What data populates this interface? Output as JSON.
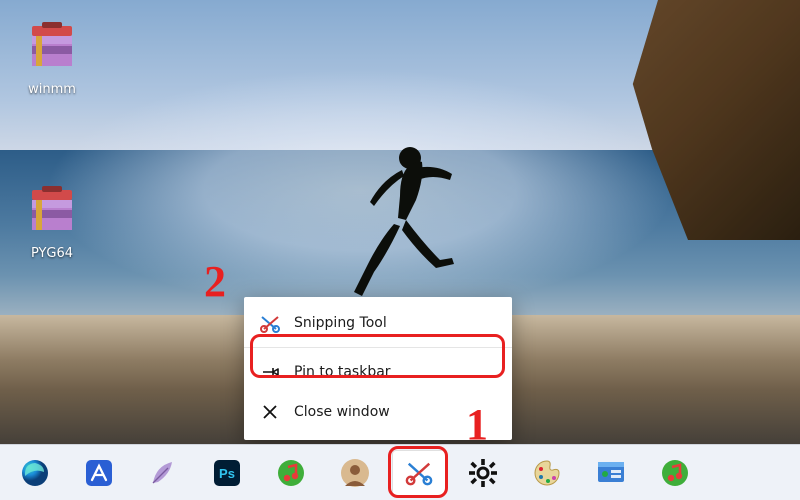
{
  "desktop": {
    "icons": [
      {
        "name": "winmm",
        "label": "winmm"
      },
      {
        "name": "pyg64",
        "label": "PYG64"
      }
    ]
  },
  "jumplist": {
    "items": [
      {
        "name": "snipping-tool",
        "label": "Snipping Tool",
        "icon": "snip"
      },
      {
        "name": "pin-to-taskbar",
        "label": "Pin to taskbar",
        "icon": "pin"
      },
      {
        "name": "close-window",
        "label": "Close window",
        "icon": "close"
      }
    ]
  },
  "taskbar": {
    "items": [
      {
        "name": "edge",
        "label": "Microsoft Edge"
      },
      {
        "name": "app-a",
        "label": "App"
      },
      {
        "name": "feather",
        "label": "Editor"
      },
      {
        "name": "photoshop",
        "label": "Photoshop"
      },
      {
        "name": "music",
        "label": "Music"
      },
      {
        "name": "avatar",
        "label": "User"
      },
      {
        "name": "snipping-tool",
        "label": "Snipping Tool"
      },
      {
        "name": "settings",
        "label": "Settings"
      },
      {
        "name": "palette",
        "label": "Paint"
      },
      {
        "name": "control-panel",
        "label": "Control Panel"
      },
      {
        "name": "music2",
        "label": "Music"
      }
    ],
    "activeIndex": 6
  },
  "callouts": {
    "n1": "1",
    "n2": "2"
  },
  "colors": {
    "highlight": "#e82020",
    "ps": "#001d34",
    "psText": "#31c5f0"
  }
}
